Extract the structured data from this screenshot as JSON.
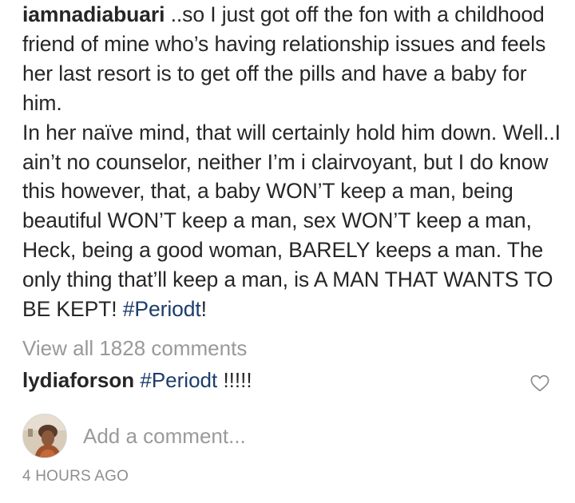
{
  "post": {
    "author": "iamnadiabuari",
    "caption_text": " ..so I just got off the fon with a childhood friend of mine who’s having relationship issues and feels her last resort is to get off the pills and have a baby for him.\nIn her naïve mind, that will certainly hold him down. Well..I ain’t no counselor, neither I’m i clairvoyant, but I do know this however, that, a baby WON’T keep a man, being beautiful WON’T keep a man, sex WON’T keep a man, Heck, being a good woman, BARELY keeps a man. The only thing that’ll keep a man, is A MAN THAT WANTS TO BE KEPT! ",
    "caption_hashtag": "#Periodt",
    "caption_tail": "!"
  },
  "comments": {
    "view_all_label": "View all 1828 comments",
    "items": [
      {
        "author": "lydiaforson",
        "hashtag": "#Periodt",
        "text": " !!!!!"
      }
    ]
  },
  "add_comment": {
    "placeholder": "Add a comment..."
  },
  "timestamp": "4 HOURS AGO",
  "icons": {
    "like": "heart-outline-icon",
    "avatar": "user-avatar"
  },
  "colors": {
    "text": "#262626",
    "hashtag": "#1d3d6b",
    "muted": "#999999"
  }
}
